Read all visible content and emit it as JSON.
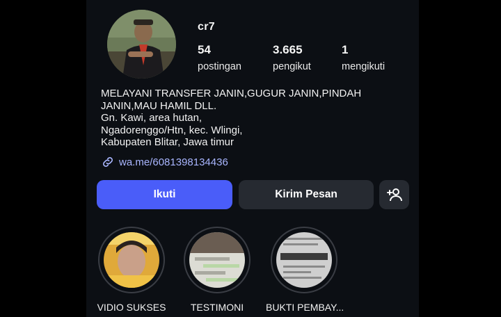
{
  "profile": {
    "username": "cr7",
    "stats": {
      "posts": {
        "value": "54",
        "label": "postingan"
      },
      "followers": {
        "value": "3.665",
        "label": "pengikut"
      },
      "following": {
        "value": "1",
        "label": "mengikuti"
      }
    },
    "bio_lines": [
      "MELAYANI TRANSFER JANIN,GUGUR JANIN,PINDAH",
      "JANIN,MAU HAMIL DLL.",
      "Gn. Kawi, area hutan,",
      "Ngadorenggo/Htn, kec. Wlingi,",
      "Kabupaten Blitar, Jawa timur"
    ],
    "link": {
      "text": "wa.me/6081398134436",
      "icon": "link-icon"
    }
  },
  "actions": {
    "follow_label": "Ikuti",
    "message_label": "Kirim Pesan",
    "add_user_icon": "add-user-icon"
  },
  "highlights": [
    {
      "title": "VIDIO SUKSES"
    },
    {
      "title": "TESTIMONI"
    },
    {
      "title": "BUKTI PEMBAY..."
    }
  ],
  "colors": {
    "background": "#0c0f14",
    "follow_button": "#4a5df9",
    "secondary_button": "#262a31",
    "link": "#a9b6ff"
  }
}
